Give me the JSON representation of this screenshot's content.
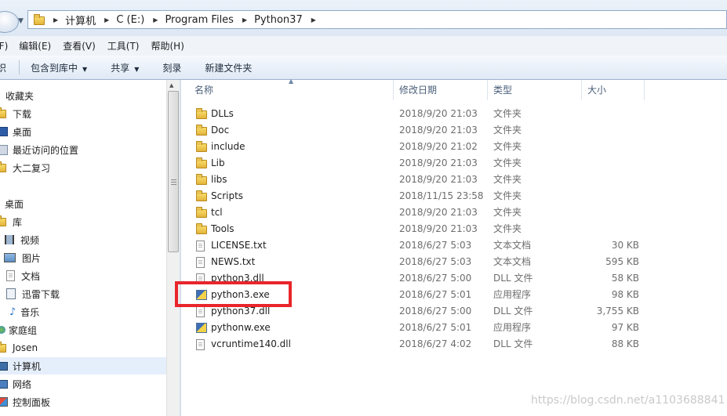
{
  "address_bar": {
    "crumbs": [
      "计算机",
      "C (E:)",
      "Program Files",
      "Python37"
    ]
  },
  "menu": {
    "file": "(F)",
    "edit": "编辑(E)",
    "view": "查看(V)",
    "tools": "工具(T)",
    "help": "帮助(H)"
  },
  "toolbar": {
    "organize": "织",
    "include_in_library": "包含到库中",
    "share": "共享",
    "burn": "刻录",
    "new_folder": "新建文件夹"
  },
  "nav": {
    "favorites": "收藏夹",
    "downloads": "下载",
    "desktop": "桌面",
    "recent": "最近访问的位置",
    "daer": "大二复习",
    "desktop_root": "桌面",
    "libraries": "库",
    "videos": "视频",
    "pictures": "图片",
    "documents": "文档",
    "xunlei": "迅雷下载",
    "music": "音乐",
    "homegroup": "家庭组",
    "user": "Josen",
    "computer": "计算机",
    "network": "网络",
    "control_panel": "控制面板"
  },
  "columns": {
    "name": "名称",
    "date": "修改日期",
    "type": "类型",
    "size": "大小"
  },
  "files": [
    {
      "name": "DLLs",
      "date": "2018/9/20 21:03",
      "type": "文件夹",
      "size": "",
      "icon": "folder"
    },
    {
      "name": "Doc",
      "date": "2018/9/20 21:03",
      "type": "文件夹",
      "size": "",
      "icon": "folder"
    },
    {
      "name": "include",
      "date": "2018/9/20 21:02",
      "type": "文件夹",
      "size": "",
      "icon": "folder"
    },
    {
      "name": "Lib",
      "date": "2018/9/20 21:03",
      "type": "文件夹",
      "size": "",
      "icon": "folder"
    },
    {
      "name": "libs",
      "date": "2018/9/20 21:03",
      "type": "文件夹",
      "size": "",
      "icon": "folder"
    },
    {
      "name": "Scripts",
      "date": "2018/11/15 23:58",
      "type": "文件夹",
      "size": "",
      "icon": "folder"
    },
    {
      "name": "tcl",
      "date": "2018/9/20 21:03",
      "type": "文件夹",
      "size": "",
      "icon": "folder"
    },
    {
      "name": "Tools",
      "date": "2018/9/20 21:03",
      "type": "文件夹",
      "size": "",
      "icon": "folder"
    },
    {
      "name": "LICENSE.txt",
      "date": "2018/6/27 5:03",
      "type": "文本文档",
      "size": "30 KB",
      "icon": "text"
    },
    {
      "name": "NEWS.txt",
      "date": "2018/6/27 5:03",
      "type": "文本文档",
      "size": "595 KB",
      "icon": "text"
    },
    {
      "name": "python3.dll",
      "date": "2018/6/27 5:00",
      "type": "DLL 文件",
      "size": "58 KB",
      "icon": "dll"
    },
    {
      "name": "python3.exe",
      "date": "2018/6/27 5:01",
      "type": "应用程序",
      "size": "98 KB",
      "icon": "exe"
    },
    {
      "name": "python37.dll",
      "date": "2018/6/27 5:00",
      "type": "DLL 文件",
      "size": "3,755 KB",
      "icon": "dll"
    },
    {
      "name": "pythonw.exe",
      "date": "2018/6/27 5:01",
      "type": "应用程序",
      "size": "97 KB",
      "icon": "exe"
    },
    {
      "name": "vcruntime140.dll",
      "date": "2018/6/27 4:02",
      "type": "DLL 文件",
      "size": "88 KB",
      "icon": "dll"
    }
  ],
  "watermark": "https://blog.csdn.net/a1103688841",
  "colors": {
    "highlight": "#e8252a",
    "selected_nav": "#e5eefb",
    "column_header": "#4c607a"
  }
}
